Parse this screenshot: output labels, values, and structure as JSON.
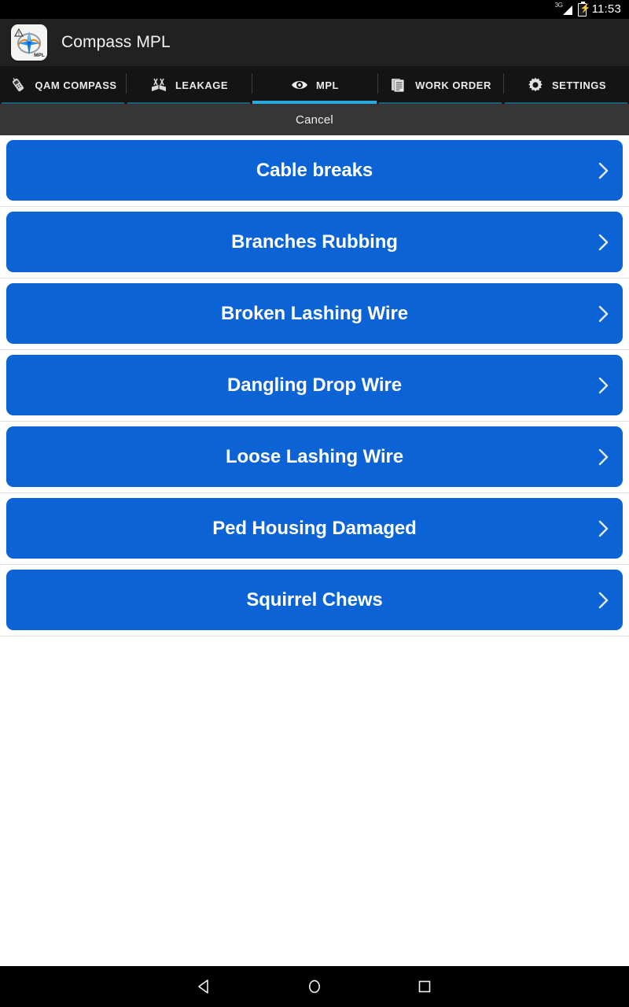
{
  "status_bar": {
    "network": "3G",
    "battery_icon": "battery-charging-icon",
    "time": "11:53"
  },
  "app_bar": {
    "icon": "compass-mpl-app-icon",
    "title": "Compass MPL"
  },
  "tabs": {
    "active_index": 2,
    "items": [
      {
        "label": "QAM COMPASS",
        "icon": "signal-meter-icon"
      },
      {
        "label": "LEAKAGE",
        "icon": "leakage-antenna-icon"
      },
      {
        "label": "MPL",
        "icon": "eye-icon"
      },
      {
        "label": "WORK ORDER",
        "icon": "documents-icon"
      },
      {
        "label": "SETTINGS",
        "icon": "gear-icon"
      }
    ]
  },
  "action_bar": {
    "cancel_label": "Cancel"
  },
  "list": {
    "items": [
      {
        "label": "Cable breaks",
        "chevron": "chevron-right-icon"
      },
      {
        "label": "Branches Rubbing",
        "chevron": "chevron-right-icon"
      },
      {
        "label": "Broken Lashing Wire",
        "chevron": "chevron-right-icon"
      },
      {
        "label": "Dangling Drop Wire",
        "chevron": "chevron-right-icon"
      },
      {
        "label": "Loose Lashing Wire",
        "chevron": "chevron-right-icon"
      },
      {
        "label": "Ped Housing Damaged",
        "chevron": "chevron-right-icon"
      },
      {
        "label": "Squirrel Chews",
        "chevron": "chevron-right-icon"
      }
    ]
  },
  "nav_bar": {
    "back": "back-nav-icon",
    "home": "home-nav-icon",
    "recents": "recents-nav-icon"
  },
  "colors": {
    "button_blue": "#0b63d6",
    "tab_active": "#2ba8dd",
    "tab_inactive_underline": "#1d5e78",
    "app_bar_bg": "#212121",
    "cancel_bar_bg": "#363636"
  }
}
